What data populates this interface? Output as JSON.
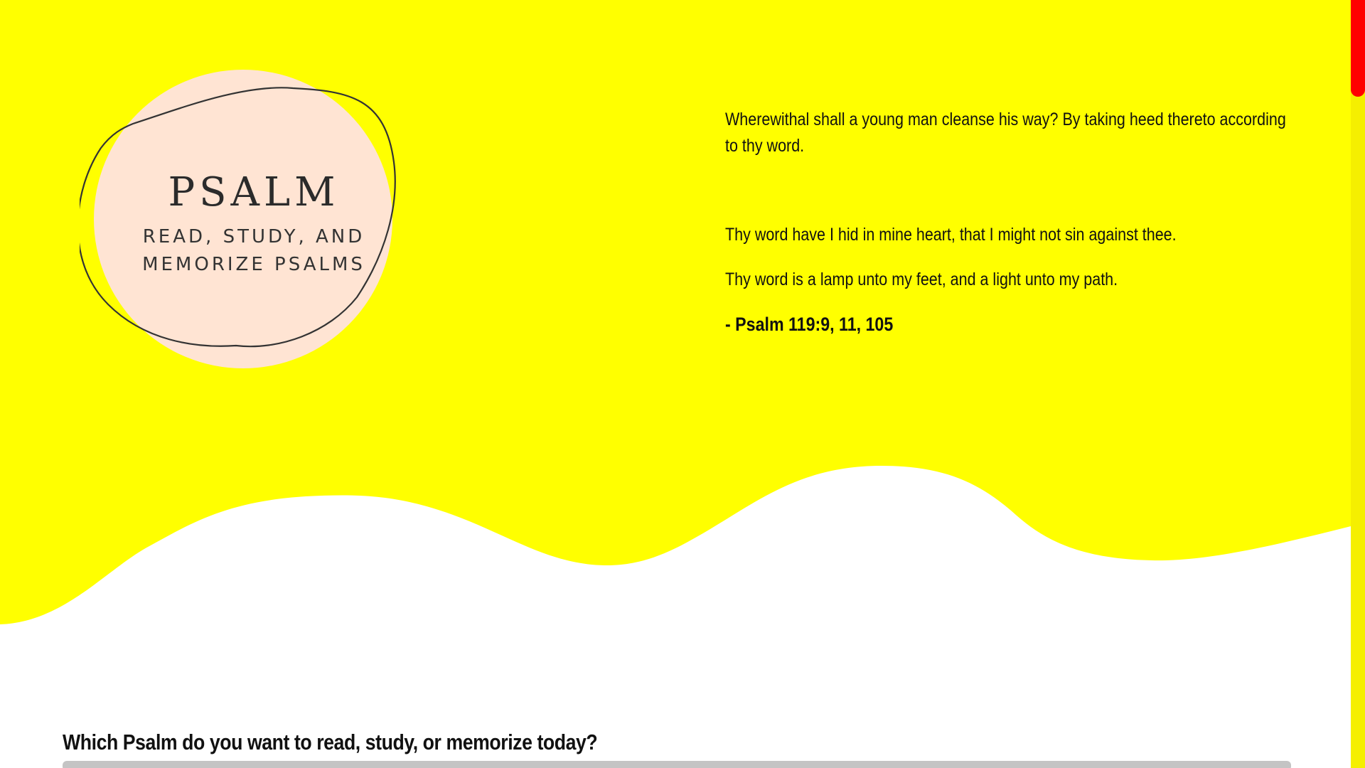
{
  "logo": {
    "title": "PSALM",
    "subtitle_line1": "READ, STUDY, AND",
    "subtitle_line2": "MEMORIZE PSALMS"
  },
  "verses": {
    "verse1": "Wherewithal shall a young man cleanse his way? By taking heed thereto according to thy word.",
    "verse2": "Thy word have I hid in mine heart, that I might not sin against thee.",
    "verse3": "Thy word is a lamp unto my feet, and a light unto my path.",
    "reference": "- Psalm 119:9, 11, 105"
  },
  "main": {
    "question": "Which Psalm do you want to read, study, or memorize today?"
  },
  "colors": {
    "hero_background": "#ffff00",
    "logo_circle": "#ffe4d3",
    "scrollbar_thumb": "#ff0000",
    "scrollbar_track": "#f5ef00"
  }
}
